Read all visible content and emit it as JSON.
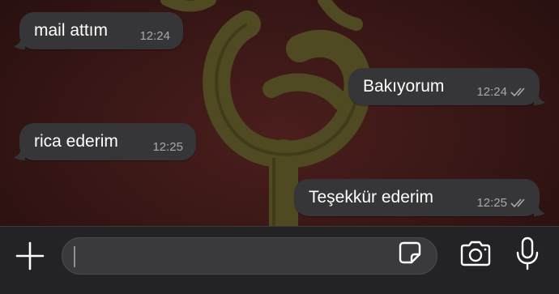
{
  "messages": [
    {
      "direction": "in",
      "text": "mail attım",
      "time": "12:24"
    },
    {
      "direction": "out",
      "text": "Bakıyorum",
      "time": "12:24",
      "status": "read"
    },
    {
      "direction": "in",
      "text": "rica ederim",
      "time": "12:25"
    },
    {
      "direction": "out",
      "text": "Teşekkür ederim",
      "time": "12:25",
      "status": "read"
    }
  ],
  "input_bar": {
    "plus_icon": "plus-icon",
    "message_value": "",
    "sticker_icon": "sticker-icon",
    "camera_icon": "camera-icon",
    "mic_icon": "microphone-icon"
  },
  "colors": {
    "bubble": "#363638",
    "wallpaper": "#361615",
    "emblem": "#4f4a22",
    "input_bar": "#232326",
    "timestamp": "#a8a8ac"
  }
}
